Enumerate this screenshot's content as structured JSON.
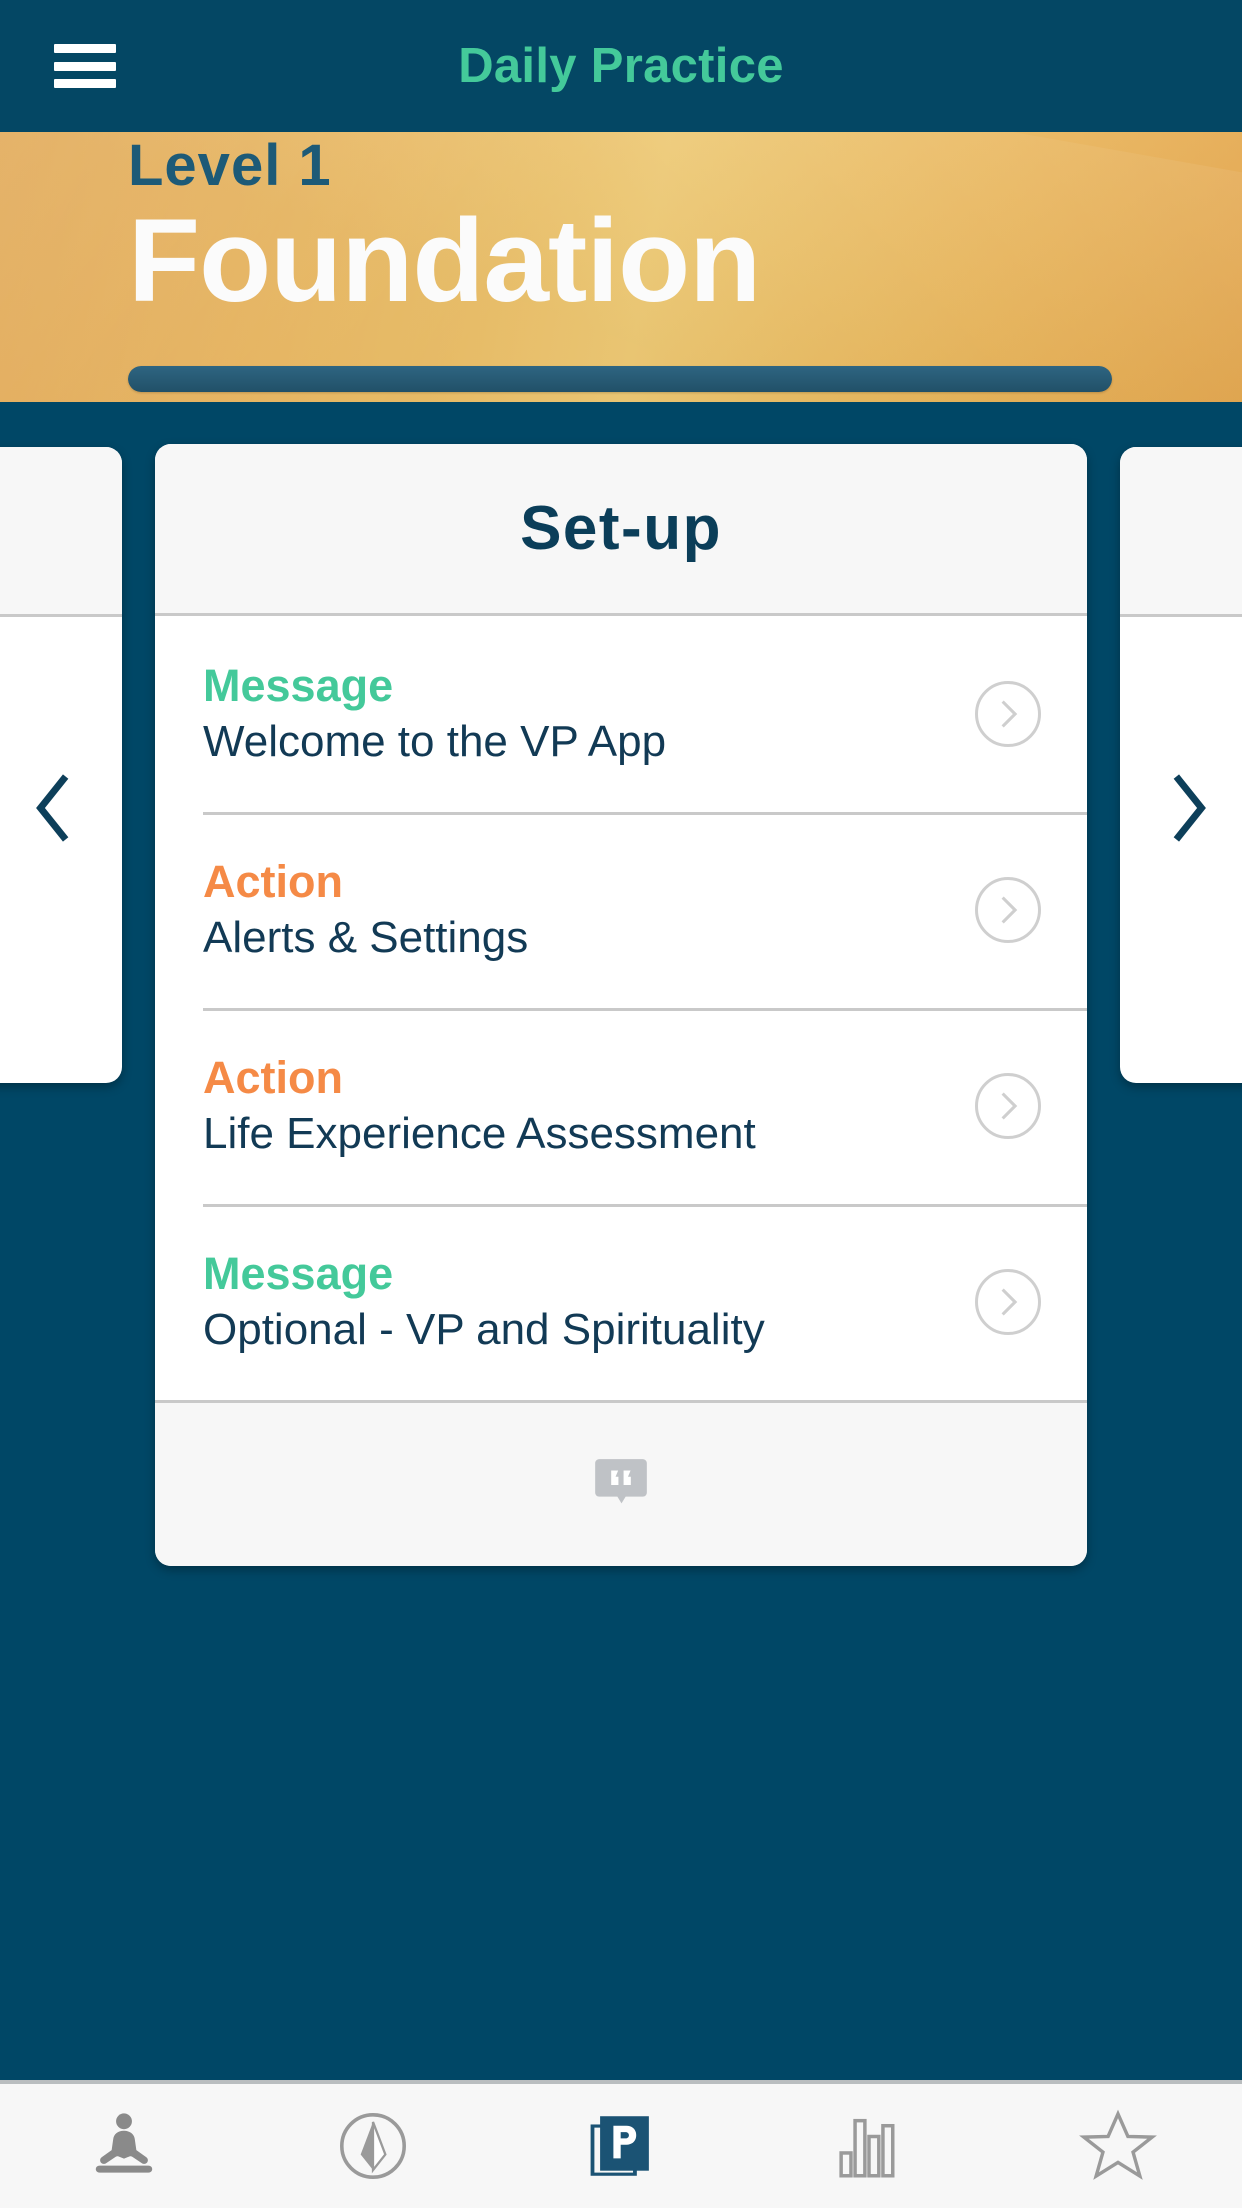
{
  "appbar": {
    "menu_icon": "hamburger-menu-icon",
    "title": "Daily Practice"
  },
  "banner": {
    "level_label": "Level 1",
    "level_title": "Foundation",
    "progress_percent": 100,
    "colors": {
      "gradient_start": "#e8a84a",
      "gradient_mid": "#f2cd77",
      "gradient_end": "#e2a142",
      "level_label_color": "#1d5a77",
      "level_title_color": "#fbfbfb",
      "progress_fill": "#2e6582"
    }
  },
  "carousel": {
    "prev_arrow_icon": "chevron-left-icon",
    "next_arrow_icon": "chevron-right-icon",
    "card": {
      "title": "Set-up",
      "items": [
        {
          "kind": "Message",
          "kind_type": "message",
          "title": "Welcome to the VP App",
          "chevron_icon": "chevron-right-circle-icon"
        },
        {
          "kind": "Action",
          "kind_type": "action",
          "title": "Alerts & Settings",
          "chevron_icon": "chevron-right-circle-icon"
        },
        {
          "kind": "Action",
          "kind_type": "action",
          "title": "Life Experience Assessment",
          "chevron_icon": "chevron-right-circle-icon"
        },
        {
          "kind": "Message",
          "kind_type": "message",
          "title": "Optional - VP and Spirituality",
          "chevron_icon": "chevron-right-circle-icon"
        }
      ],
      "footer_icon": "quote-bubble-icon"
    }
  },
  "bottom_nav": {
    "items": [
      {
        "icon": "meditation-icon",
        "active": false
      },
      {
        "icon": "compass-navigation-icon",
        "active": false
      },
      {
        "icon": "practice-p-book-icon",
        "active": true
      },
      {
        "icon": "bar-chart-icon",
        "active": false
      },
      {
        "icon": "star-icon",
        "active": false
      }
    ]
  },
  "colors": {
    "background": "#004766",
    "appbar": "#044764",
    "accent_green": "#44c99a",
    "accent_orange": "#f58a46",
    "text_dark": "#123a55",
    "card_bg": "#ffffff",
    "card_alt_bg": "#f7f7f7",
    "divider": "#c9c9c9",
    "nav_inactive": "#8a8a8a",
    "nav_active": "#1b5374"
  }
}
